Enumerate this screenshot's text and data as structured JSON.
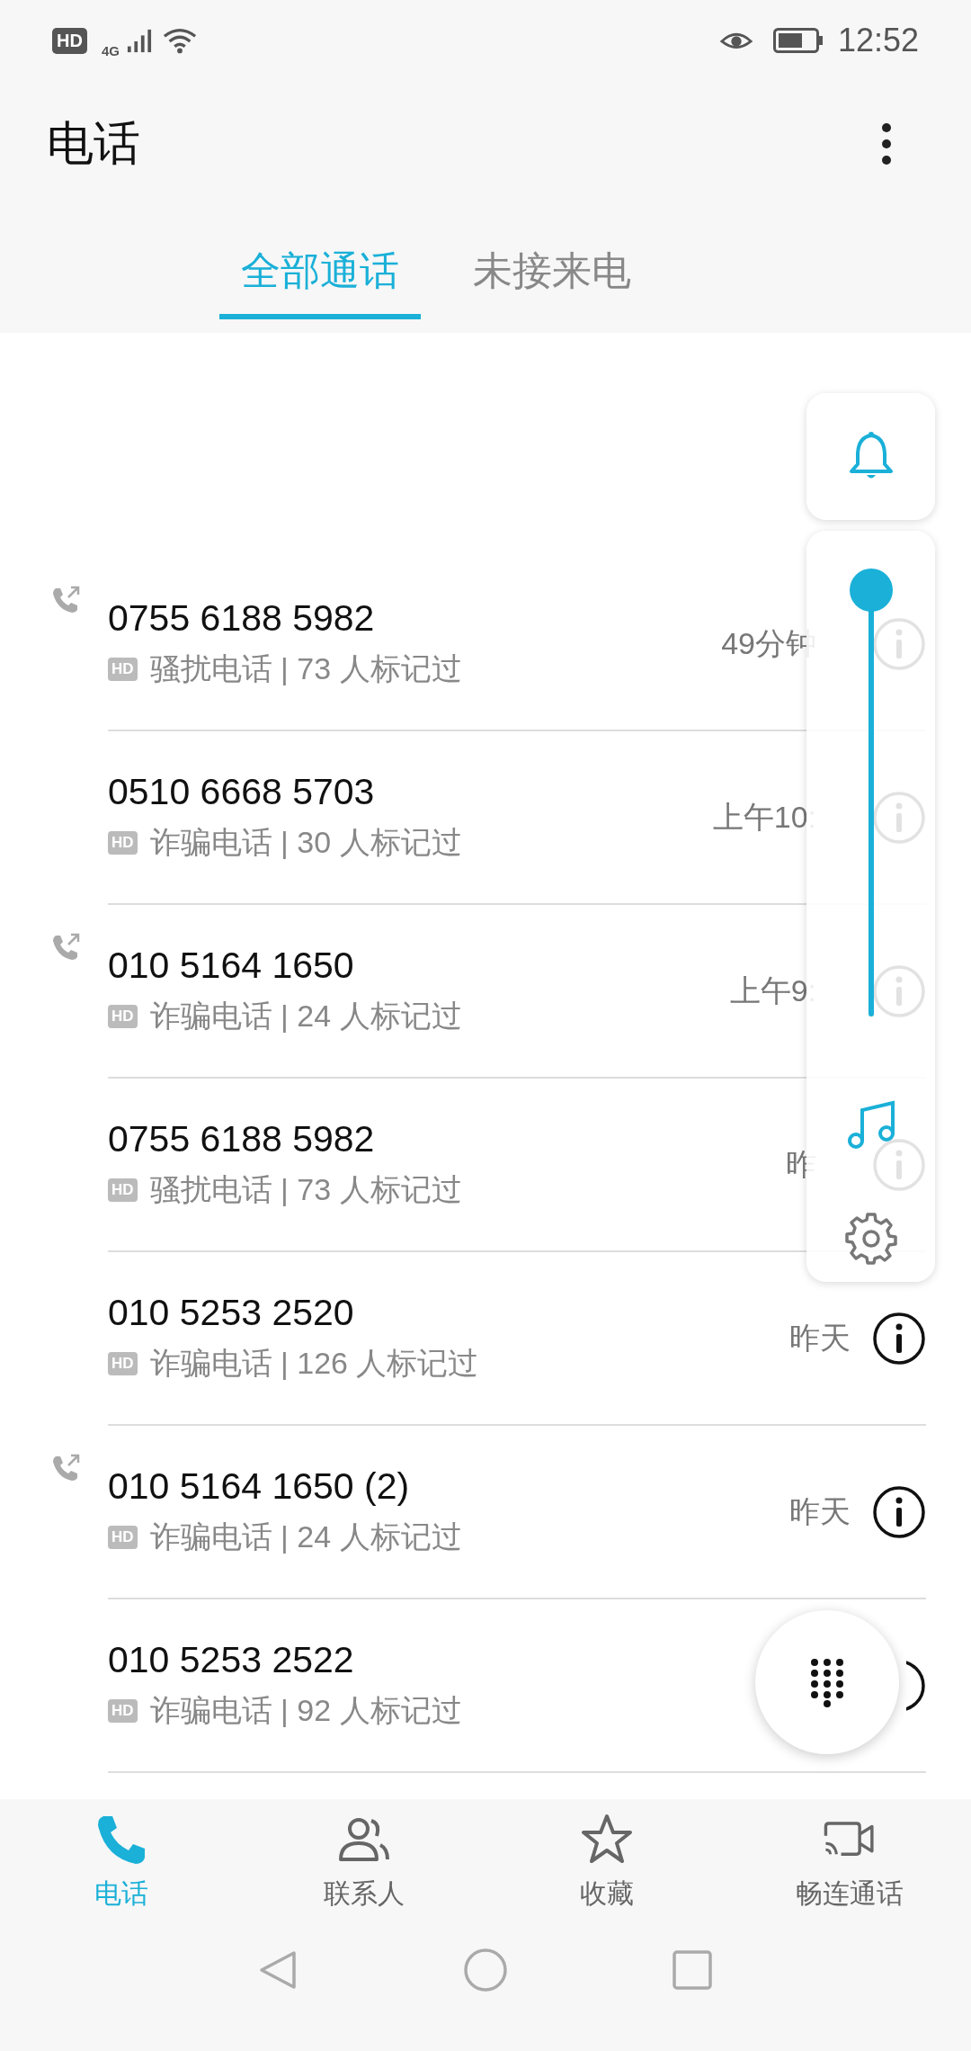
{
  "status_bar": {
    "hd": "HD",
    "network": "4G",
    "time": "12:52"
  },
  "title": "电话",
  "tabs": [
    {
      "label": "全部通话",
      "selected": true
    },
    {
      "label": "未接来电",
      "selected": false
    }
  ],
  "calls": [
    {
      "number": "0755 6188 5982",
      "badge": "HD",
      "label": "骚扰电话 | 73 人标记过",
      "outgoing": true,
      "time": "49分钟"
    },
    {
      "number": "0510 6668 5703",
      "badge": "HD",
      "label": "诈骗电话 | 30 人标记过",
      "outgoing": false,
      "time": "上午10:"
    },
    {
      "number": "010 5164 1650",
      "badge": "HD",
      "label": "诈骗电话 | 24 人标记过",
      "outgoing": true,
      "time": "上午9:"
    },
    {
      "number": "0755 6188 5982",
      "badge": "HD",
      "label": "骚扰电话 | 73 人标记过",
      "outgoing": false,
      "time": "昨"
    },
    {
      "number": "010 5253 2520",
      "badge": "HD",
      "label": "诈骗电话 | 126 人标记过",
      "outgoing": false,
      "time": "昨天"
    },
    {
      "number": "010 5164 1650 (2)",
      "badge": "HD",
      "label": "诈骗电话 | 24 人标记过",
      "outgoing": true,
      "time": "昨天"
    },
    {
      "number": "010 5253 2522",
      "badge": "HD",
      "label": "诈骗电话 | 92 人标记过",
      "outgoing": false
    }
  ],
  "volume_panel": {
    "level": 1
  },
  "bottom_nav": [
    {
      "label": "电话",
      "kind": "phone",
      "selected": true
    },
    {
      "label": "联系人",
      "kind": "contacts",
      "selected": false
    },
    {
      "label": "收藏",
      "kind": "star",
      "selected": false
    },
    {
      "label": "畅连通话",
      "kind": "video",
      "selected": false
    }
  ]
}
